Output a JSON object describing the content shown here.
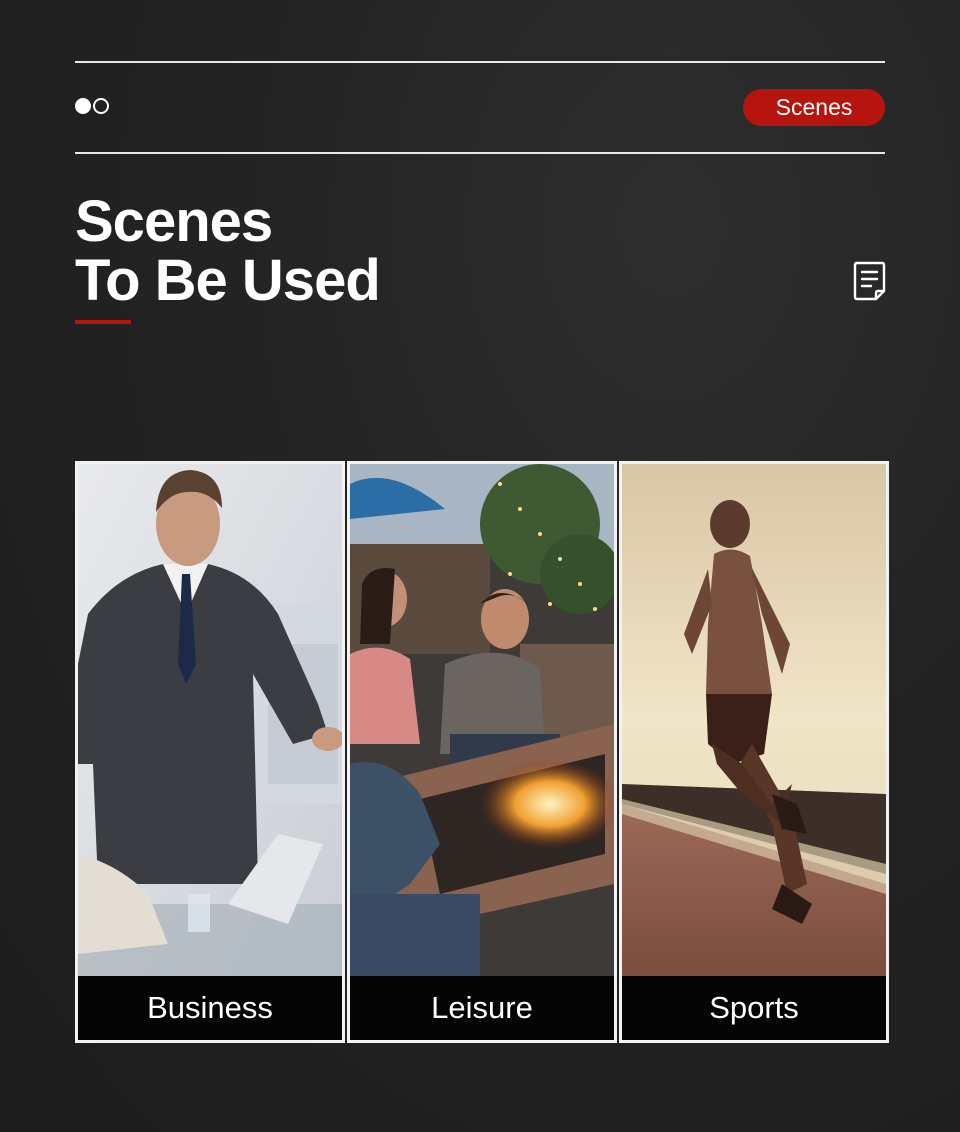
{
  "header": {
    "badge_label": "Scenes"
  },
  "title": {
    "line1": "Scenes",
    "line2": "To Be Used"
  },
  "icons": {
    "indicator": "dots-icon",
    "document": "document-icon"
  },
  "colors": {
    "accent": "#b5140f",
    "background": "#232323",
    "rule": "#e8e8e8"
  },
  "cards": [
    {
      "label": "Business"
    },
    {
      "label": "Leisure"
    },
    {
      "label": "Sports"
    }
  ]
}
